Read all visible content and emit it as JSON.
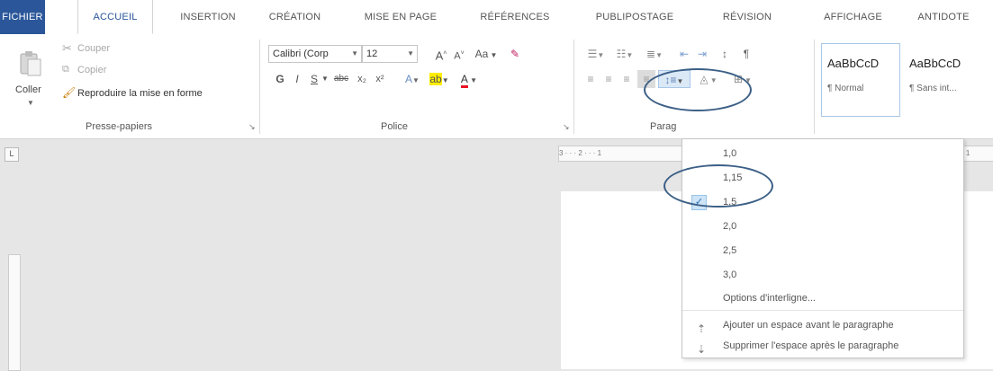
{
  "tabs": [
    {
      "label": "FICHIER"
    },
    {
      "label": "ACCUEIL"
    },
    {
      "label": "INSERTION"
    },
    {
      "label": "CRÉATION"
    },
    {
      "label": "MISE EN PAGE"
    },
    {
      "label": "RÉFÉRENCES"
    },
    {
      "label": "PUBLIPOSTAGE"
    },
    {
      "label": "RÉVISION"
    },
    {
      "label": "AFFICHAGE"
    },
    {
      "label": "ANTIDOTE"
    }
  ],
  "clipboard": {
    "paste_label": "Coller",
    "cut_label": "Couper",
    "copy_label": "Copier",
    "format_painter_label": "Reproduire la mise en forme",
    "group_label": "Presse-papiers"
  },
  "font": {
    "font_name": "Calibri (Corp",
    "font_size": "12",
    "change_case_label": "Aa",
    "group_label": "Police",
    "bold": "G",
    "italic": "I",
    "underline": "S",
    "strike": "abc",
    "subscript": "x₂",
    "superscript": "x²"
  },
  "paragraph": {
    "group_label": "Parag"
  },
  "styles": [
    {
      "sample": "AaBbCcD",
      "name": "¶ Normal"
    },
    {
      "sample": "AaBbCcD",
      "name": "¶ Sans int..."
    }
  ],
  "ruler_text": "3 · · · 2 · · · 1",
  "ruler_right_text": "· 1",
  "line_spacing_menu": {
    "options": [
      "1,0",
      "1,15",
      "1,5",
      "2,0",
      "2,5",
      "3,0"
    ],
    "selected": "1,5",
    "options_link": "Options d'interligne...",
    "add_space_before": "Ajouter un espace avant le paragraphe",
    "remove_space_after": "Supprimer l'espace après le paragraphe"
  },
  "colors": {
    "file_tab": "#2b579a",
    "accent": "#2b579a",
    "annotation": "#3b5f86"
  }
}
